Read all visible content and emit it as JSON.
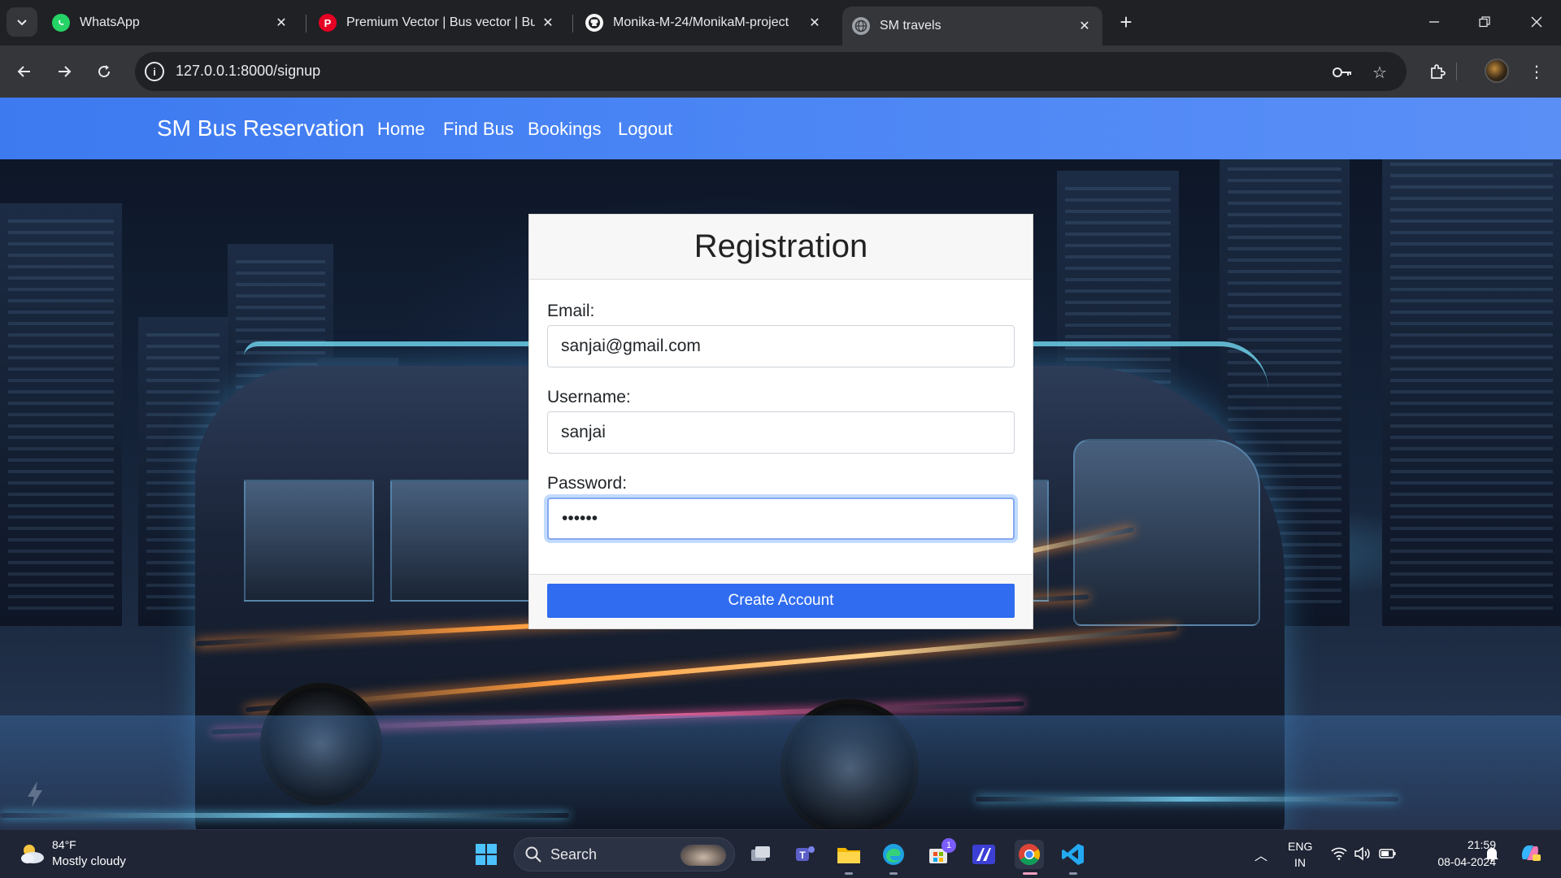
{
  "browser": {
    "tabs": [
      {
        "title": "WhatsApp",
        "active": false,
        "favicon": "whatsapp-icon"
      },
      {
        "title": "Premium Vector | Bus vector | Bus",
        "active": false,
        "favicon": "pinterest-icon"
      },
      {
        "title": "Monika-M-24/MonikaM-project",
        "active": false,
        "favicon": "github-icon"
      },
      {
        "title": "SM travels",
        "active": true,
        "favicon": "globe-icon"
      }
    ],
    "url": "127.0.0.1:8000/signup"
  },
  "site": {
    "brand": "SM Bus Reservation",
    "nav": [
      "Home",
      "Find Bus",
      "Bookings",
      "Logout"
    ]
  },
  "form": {
    "title": "Registration",
    "email_label": "Email:",
    "email_value": "sanjai@gmail.com",
    "username_label": "Username:",
    "username_value": "sanjai",
    "password_label": "Password:",
    "password_value": "••••••",
    "submit_label": "Create Account"
  },
  "taskbar": {
    "weather_temp": "84°F",
    "weather_desc": "Mostly cloudy",
    "search_label": "Search",
    "lang_line1": "ENG",
    "lang_line2": "IN",
    "time": "21:59",
    "date": "08-04-2024",
    "store_badge": "1"
  },
  "colors": {
    "navbar": "#4b82f3",
    "button": "#2f6cf0",
    "chrome_dark": "#202124"
  }
}
